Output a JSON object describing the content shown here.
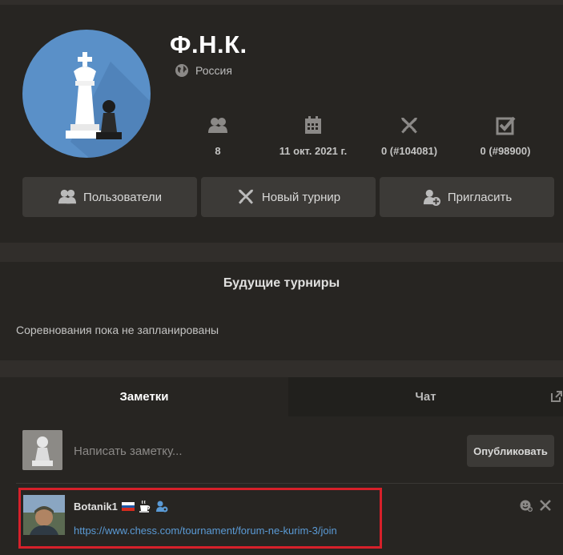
{
  "club": {
    "name": "Ф.Н.К.",
    "country": "Россия",
    "logo_icon": "chess-king-pawn-logo"
  },
  "stats": [
    {
      "icon": "members-icon",
      "value": "8"
    },
    {
      "icon": "calendar-icon",
      "value": "11 окт. 2021 г."
    },
    {
      "icon": "crossed-swords-icon",
      "value": "0 (#104081)"
    },
    {
      "icon": "checkmark-box-icon",
      "value": "0 (#98900)"
    }
  ],
  "actions": {
    "members": "Пользователи",
    "new_tournament": "Новый турнир",
    "invite": "Пригласить"
  },
  "tournaments": {
    "title": "Будущие турниры",
    "empty_text": "Соревнования пока не запланированы"
  },
  "tabs": {
    "notes": "Заметки",
    "chat": "Чат"
  },
  "notes": {
    "placeholder": "Написать заметку...",
    "publish": "Опубликовать"
  },
  "post": {
    "username": "Botanik1",
    "flag": "russia-flag",
    "link": "https://www.chess.com/tournament/forum-ne-kurim-3/join"
  },
  "colors": {
    "accent_link": "#5a9ad5",
    "highlight_border": "#d6202a",
    "logo_bg": "#5a90c8"
  }
}
